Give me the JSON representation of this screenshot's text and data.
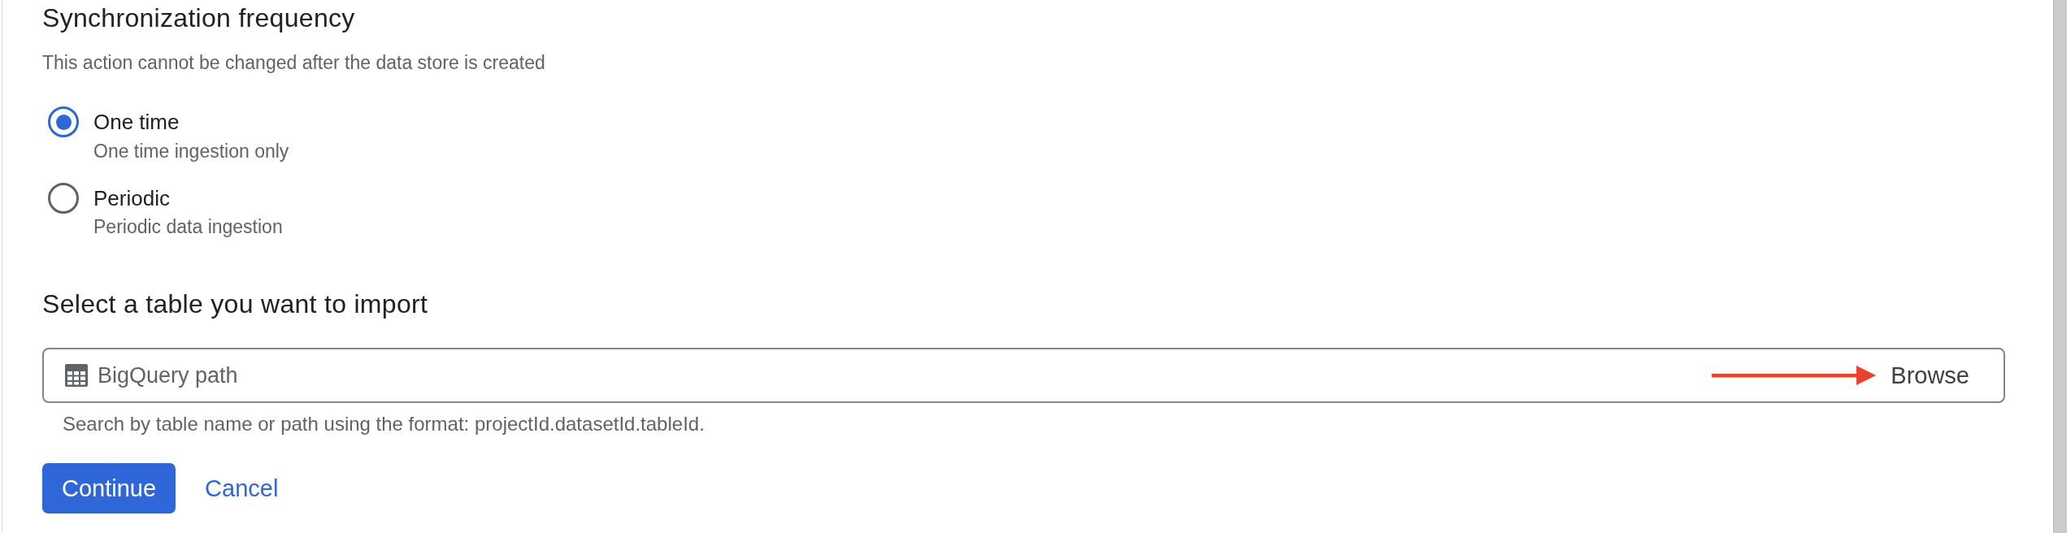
{
  "sync_section": {
    "title": "Synchronization frequency",
    "note": "This action cannot be changed after the data store is created"
  },
  "sync_options": [
    {
      "label": "One time",
      "description": "One time ingestion only",
      "selected": true
    },
    {
      "label": "Periodic",
      "description": "Periodic data ingestion",
      "selected": false
    }
  ],
  "table_section": {
    "title": "Select a table you want to import",
    "path_field": {
      "placeholder": "BigQuery path",
      "hint": "Search by table name or path using the format: projectId.datasetId.tableId.",
      "browse_button": "Browse"
    }
  },
  "actions": [
    {
      "label": "Continue",
      "kind": "primary"
    },
    {
      "label": "Cancel",
      "kind": "text"
    }
  ]
}
